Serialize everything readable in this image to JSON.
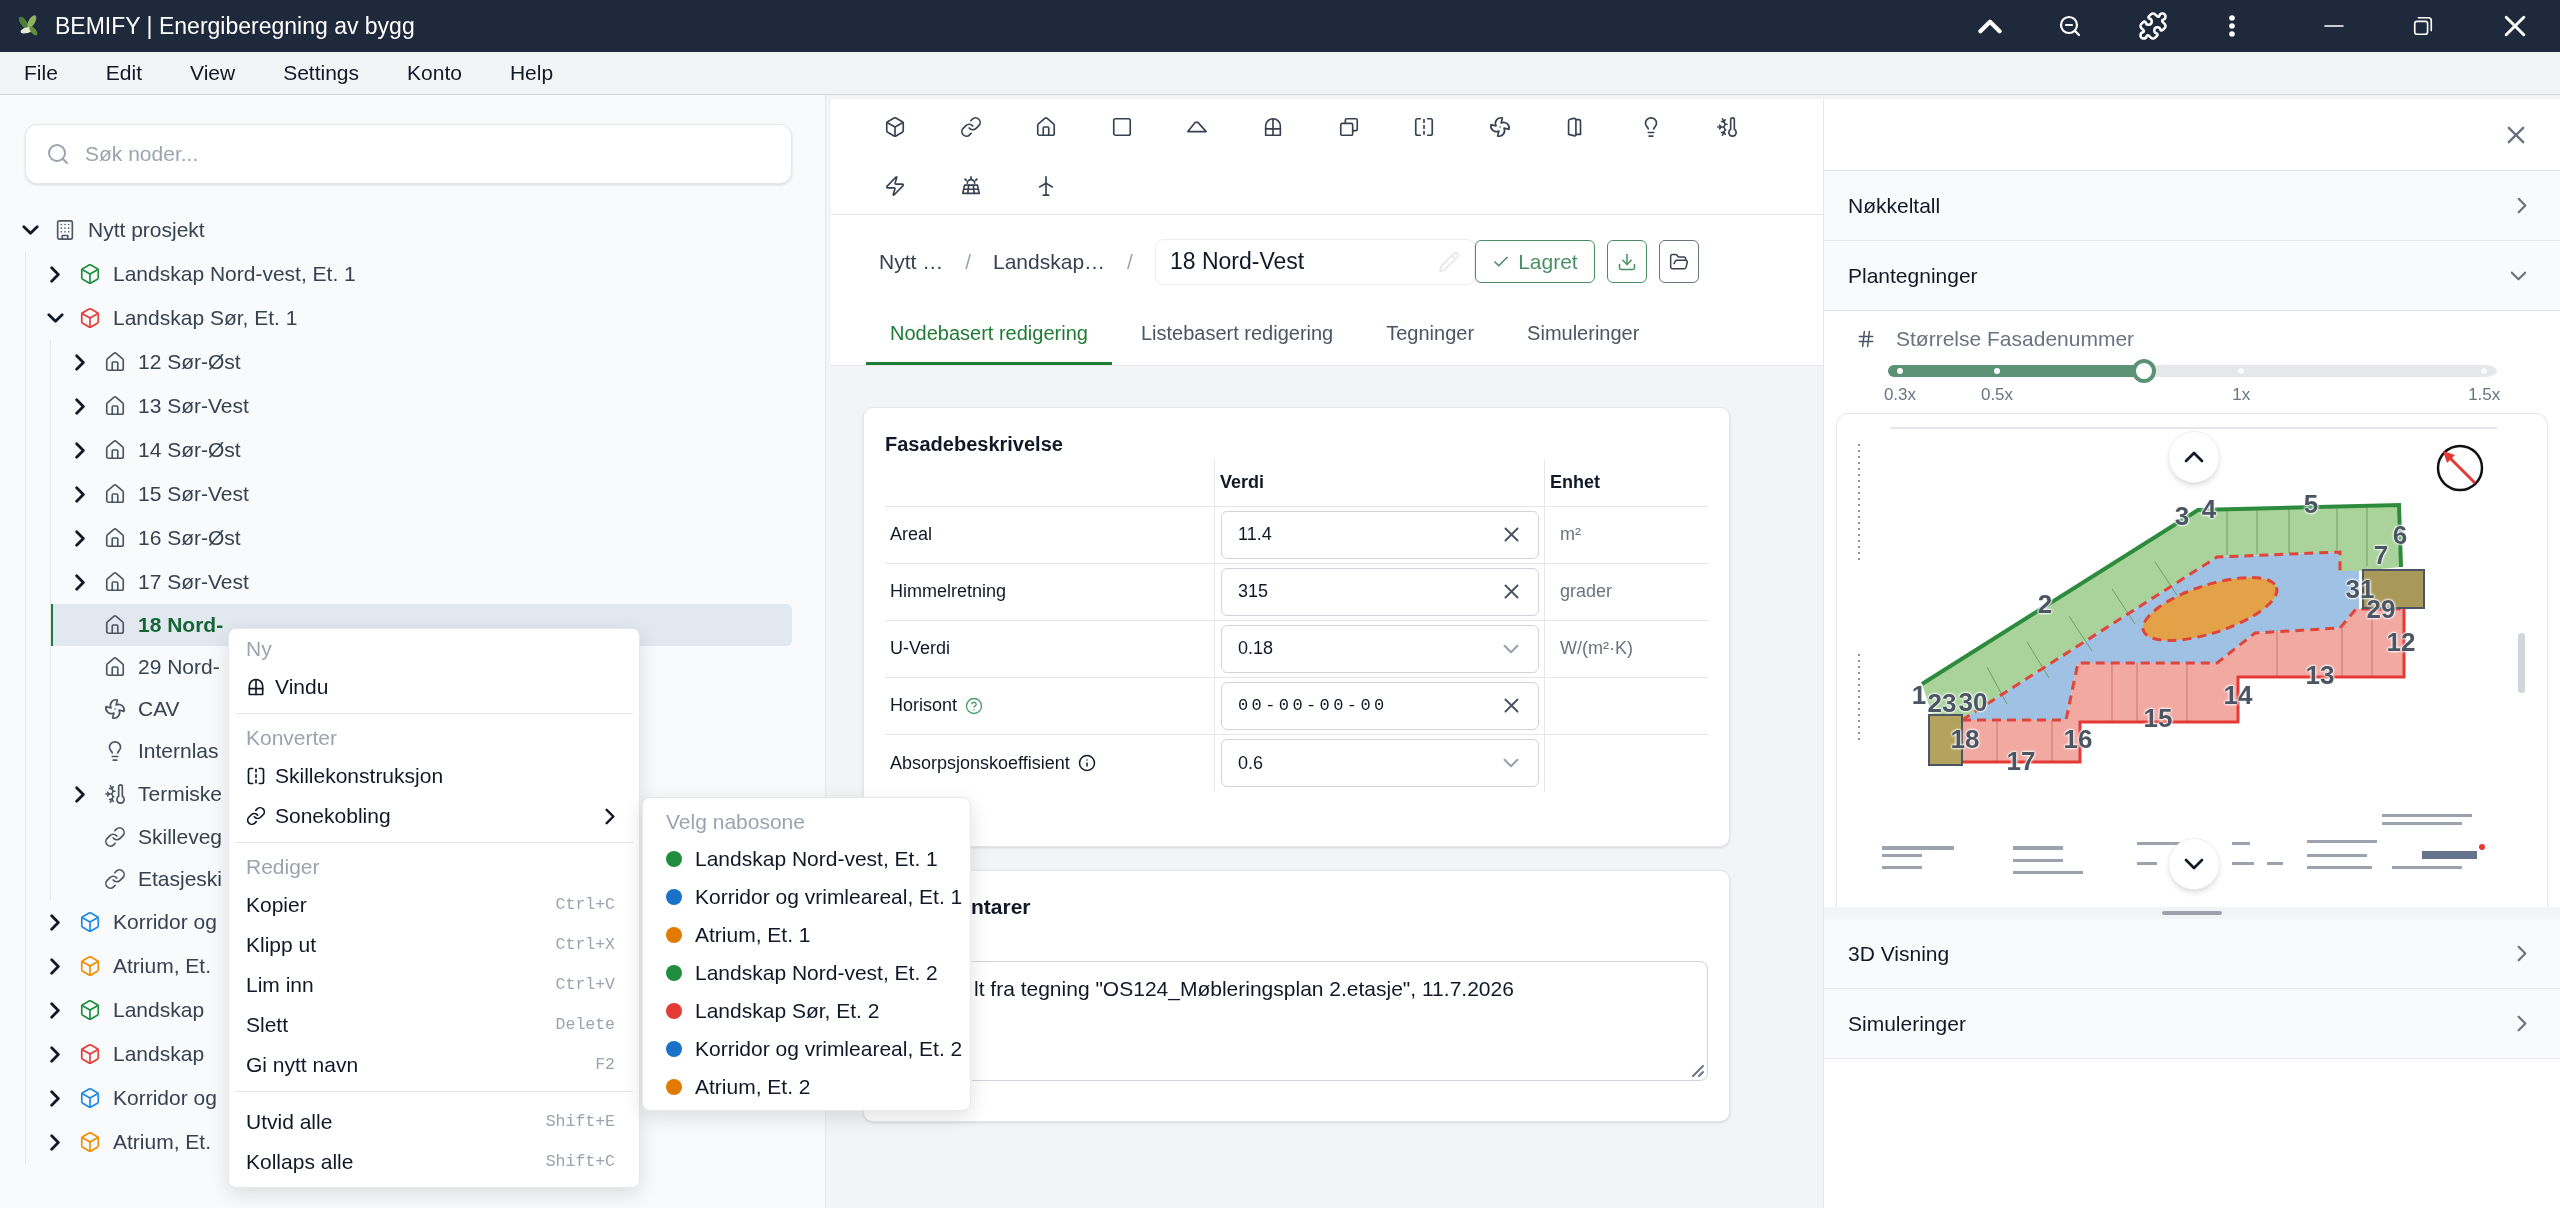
{
  "window": {
    "title": "BEMIFY | Energiberegning av bygg"
  },
  "menu_bar": [
    "File",
    "Edit",
    "View",
    "Settings",
    "Konto",
    "Help"
  ],
  "tree": {
    "search": {
      "placeholder": "Søk noder..."
    },
    "nodes": [
      {
        "label": "Nytt prosjekt",
        "kind": "project",
        "expanded": true,
        "selected": false,
        "children": [
          {
            "label": "Landskap Nord-vest, Et. 1",
            "kind": "zone",
            "color": "#1e8e3e",
            "expanded": false,
            "selected": false
          },
          {
            "label": "Landskap Sør, Et. 1",
            "kind": "zone",
            "color": "#e53935",
            "expanded": true,
            "selected": false,
            "children": [
              {
                "label": "12 Sør-Øst",
                "kind": "room",
                "expanded": false,
                "selected": false
              },
              {
                "label": "13 Sør-Vest",
                "kind": "room",
                "expanded": false,
                "selected": false
              },
              {
                "label": "14 Sør-Øst",
                "kind": "room",
                "expanded": false,
                "selected": false
              },
              {
                "label": "15 Sør-Vest",
                "kind": "room",
                "expanded": false,
                "selected": false
              },
              {
                "label": "16 Sør-Øst",
                "kind": "room",
                "expanded": false,
                "selected": false
              },
              {
                "label": "17 Sør-Vest",
                "kind": "room",
                "expanded": false,
                "selected": false
              },
              {
                "label": "18 Nord-",
                "kind": "room",
                "selected": true
              },
              {
                "label": "29 Nord-",
                "kind": "room",
                "selected": false
              },
              {
                "label": "CAV",
                "kind": "ventilation",
                "selected": false
              },
              {
                "label": "Internlas",
                "kind": "lighting",
                "selected": false
              },
              {
                "label": "Termiske",
                "kind": "thermal",
                "expanded": false,
                "selected": false
              },
              {
                "label": "Skilleveg",
                "kind": "link",
                "selected": false
              },
              {
                "label": "Etasjeski",
                "kind": "link",
                "selected": false
              }
            ]
          },
          {
            "label": "Korridor og",
            "kind": "zone",
            "color": "#1e88e5",
            "expanded": false,
            "selected": false
          },
          {
            "label": "Atrium, Et.",
            "kind": "zone",
            "color": "#f08c00",
            "expanded": false,
            "selected": false
          },
          {
            "label": "Landskap",
            "kind": "zone",
            "color": "#1e8e3e",
            "expanded": false,
            "selected": false
          },
          {
            "label": "Landskap",
            "kind": "zone",
            "color": "#e53935",
            "expanded": false,
            "selected": false
          },
          {
            "label": "Korridor og",
            "kind": "zone",
            "color": "#1e88e5",
            "expanded": false,
            "selected": false
          },
          {
            "label": "Atrium, Et.",
            "kind": "zone",
            "color": "#f08c00",
            "expanded": false,
            "selected": false
          }
        ]
      }
    ]
  },
  "context_menu": {
    "sections": [
      {
        "header": "Ny",
        "items": [
          {
            "label": "Vindu",
            "kind": "window"
          }
        ]
      },
      {
        "header": "Konverter",
        "items": [
          {
            "label": "Skillekonstruksjon",
            "kind": "partition"
          },
          {
            "label": "Sonekobling",
            "kind": "submenu"
          }
        ]
      },
      {
        "header": "Rediger",
        "items": [
          {
            "label": "Kopier",
            "kind": "command",
            "shortcut": "Ctrl+C"
          },
          {
            "label": "Klipp ut",
            "kind": "command",
            "shortcut": "Ctrl+X"
          },
          {
            "label": "Lim inn",
            "kind": "command",
            "shortcut": "Ctrl+V"
          },
          {
            "label": "Slett",
            "kind": "command",
            "shortcut": "Delete"
          },
          {
            "label": "Gi nytt navn",
            "kind": "command",
            "shortcut": "F2"
          }
        ]
      },
      {
        "items": [
          {
            "label": "Utvid alle",
            "kind": "command",
            "shortcut": "Shift+E"
          },
          {
            "label": "Kollaps alle",
            "kind": "command",
            "shortcut": "Shift+C"
          }
        ]
      }
    ],
    "submenu": {
      "header": "Velg nabosone",
      "items": [
        {
          "label": "Landskap Nord-vest, Et. 1",
          "color": "#1e8e3e"
        },
        {
          "label": "Korridor og vrimleareal, Et. 1",
          "color": "#1a73c8"
        },
        {
          "label": "Atrium, Et. 1",
          "color": "#e07b00"
        },
        {
          "label": "Landskap Nord-vest, Et. 2",
          "color": "#1e8e3e"
        },
        {
          "label": "Landskap Sør, Et. 2",
          "color": "#e53935"
        },
        {
          "label": "Korridor og vrimleareal, Et. 2",
          "color": "#1a73c8"
        },
        {
          "label": "Atrium, Et. 2",
          "color": "#e07b00"
        }
      ]
    }
  },
  "breadcrumb": {
    "items": [
      {
        "label": "Nytt …"
      },
      {
        "label": "Landskap…"
      }
    ],
    "separators": [
      "/",
      "/"
    ]
  },
  "name_field": {
    "value": "18 Nord-Vest"
  },
  "save_status": {
    "label": "Lagret"
  },
  "tabs": [
    {
      "label": "Nodebasert redigering",
      "selected": true
    },
    {
      "label": "Listebasert redigering",
      "selected": false
    },
    {
      "label": "Tegninger",
      "selected": false
    },
    {
      "label": "Simuleringer",
      "selected": false
    }
  ],
  "facade": {
    "title": "Fasadebeskrivelse",
    "columns": [
      "Verdi",
      "Enhet"
    ],
    "rows": [
      {
        "label": "Areal",
        "kind": "number",
        "value": "11.4",
        "unit": "m²"
      },
      {
        "label": "Himmelretning",
        "kind": "number",
        "value": "315",
        "unit": "grader"
      },
      {
        "label": "U-Verdi",
        "kind": "select",
        "value": "0.18",
        "unit": "W/(m²·K)"
      },
      {
        "label": "Horisont",
        "kind": "masked",
        "value": "00-00-00-00",
        "note": {
          "kind": "help"
        }
      },
      {
        "label": "Absorpsjonskoeffisient",
        "kind": "select",
        "value": "0.6",
        "note": {
          "kind": "info"
        }
      }
    ]
  },
  "comments": {
    "title": "ntarer",
    "text": "lt fra tegning \"OS124_Møbleringsplan 2.etasje\", 11.7.2026"
  },
  "side_panel": {
    "sections": [
      {
        "label": "Nøkkeltall",
        "expanded": false
      },
      {
        "label": "Plantegninger",
        "expanded": true
      },
      {
        "label": "3D Visning",
        "expanded": false
      },
      {
        "label": "Simuleringer",
        "expanded": false
      }
    ],
    "number_size": {
      "label": "Størrelse Fasadenummer",
      "level": 0.42,
      "ticks": [
        "0.3x",
        "0.5x",
        "1x",
        "1.5x"
      ]
    },
    "facade_numbers": [
      "3",
      "4",
      "5",
      "6",
      "7",
      "2",
      "31",
      "29",
      "12",
      "13",
      "14",
      "15",
      "16",
      "17",
      "1",
      "23",
      "30",
      "18"
    ]
  }
}
